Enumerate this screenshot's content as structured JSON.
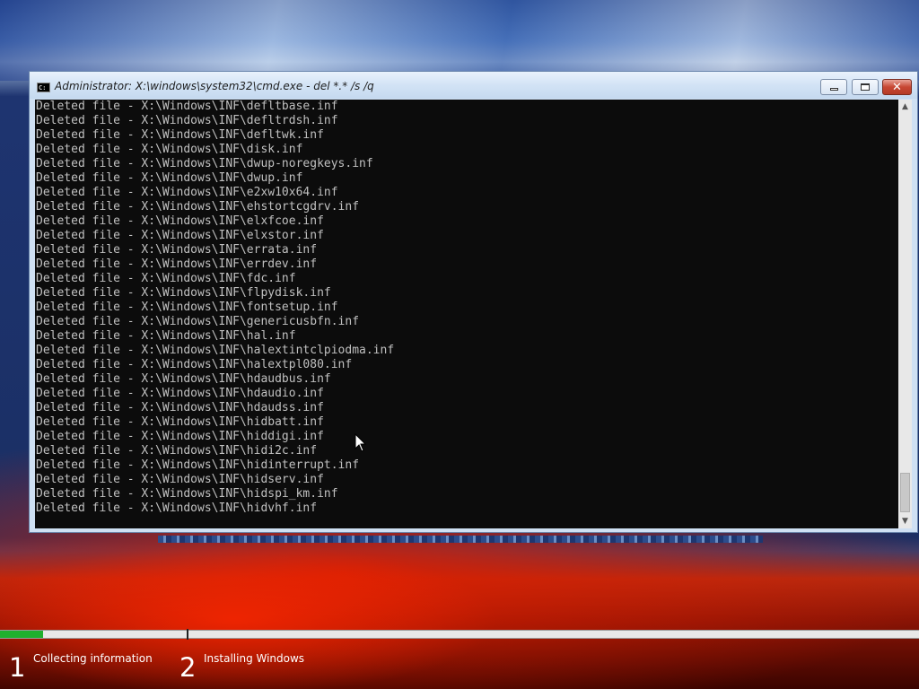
{
  "window": {
    "title": "Administrator: X:\\windows\\system32\\cmd.exe - del *.* /s /q",
    "icon": "cmd-icon",
    "buttons": {
      "minimize": "minimize-icon",
      "maximize": "maximize-icon",
      "close": "close-icon",
      "close_glyph": "✕"
    }
  },
  "console": {
    "lines": [
      "Deleted file - X:\\Windows\\INF\\defltbase.inf",
      "Deleted file - X:\\Windows\\INF\\defltrdsh.inf",
      "Deleted file - X:\\Windows\\INF\\defltwk.inf",
      "Deleted file - X:\\Windows\\INF\\disk.inf",
      "Deleted file - X:\\Windows\\INF\\dwup-noregkeys.inf",
      "Deleted file - X:\\Windows\\INF\\dwup.inf",
      "Deleted file - X:\\Windows\\INF\\e2xw10x64.inf",
      "Deleted file - X:\\Windows\\INF\\ehstortcgdrv.inf",
      "Deleted file - X:\\Windows\\INF\\elxfcoe.inf",
      "Deleted file - X:\\Windows\\INF\\elxstor.inf",
      "Deleted file - X:\\Windows\\INF\\errata.inf",
      "Deleted file - X:\\Windows\\INF\\errdev.inf",
      "Deleted file - X:\\Windows\\INF\\fdc.inf",
      "Deleted file - X:\\Windows\\INF\\flpydisk.inf",
      "Deleted file - X:\\Windows\\INF\\fontsetup.inf",
      "Deleted file - X:\\Windows\\INF\\genericusbfn.inf",
      "Deleted file - X:\\Windows\\INF\\hal.inf",
      "Deleted file - X:\\Windows\\INF\\halextintclpiodma.inf",
      "Deleted file - X:\\Windows\\INF\\halextpl080.inf",
      "Deleted file - X:\\Windows\\INF\\hdaudbus.inf",
      "Deleted file - X:\\Windows\\INF\\hdaudio.inf",
      "Deleted file - X:\\Windows\\INF\\hdaudss.inf",
      "Deleted file - X:\\Windows\\INF\\hidbatt.inf",
      "Deleted file - X:\\Windows\\INF\\hiddigi.inf",
      "Deleted file - X:\\Windows\\INF\\hidi2c.inf",
      "Deleted file - X:\\Windows\\INF\\hidinterrupt.inf",
      "Deleted file - X:\\Windows\\INF\\hidserv.inf",
      "Deleted file - X:\\Windows\\INF\\hidspi_km.inf",
      "Deleted file - X:\\Windows\\INF\\hidvhf.inf"
    ],
    "text_color": "#c0c0c0",
    "background": "#0c0c0c"
  },
  "scrollbar": {
    "up_glyph": "▲",
    "down_glyph": "▼"
  },
  "setup": {
    "progress_fraction": 0.047,
    "progress_color": "#1fb02e",
    "steps": [
      {
        "number": "1",
        "label": "Collecting information"
      },
      {
        "number": "2",
        "label": "Installing Windows"
      }
    ]
  }
}
